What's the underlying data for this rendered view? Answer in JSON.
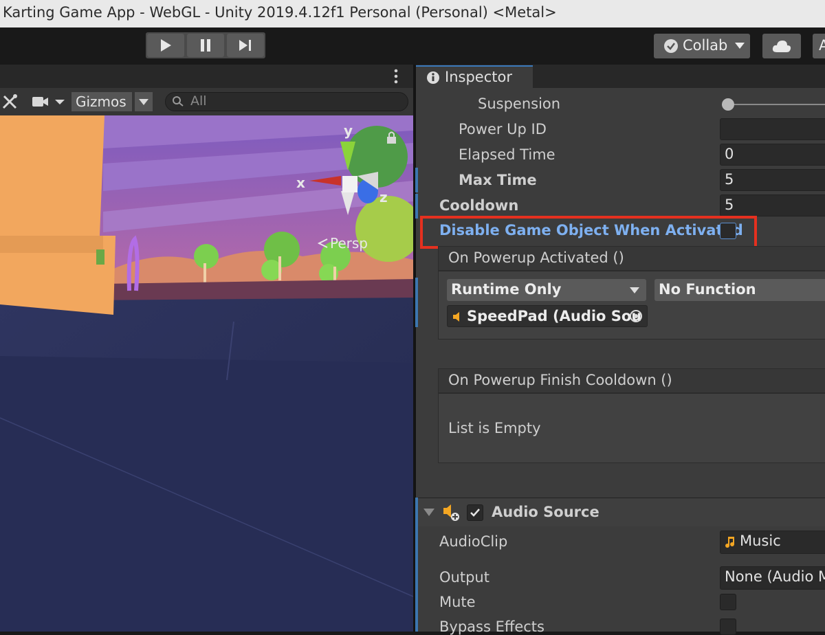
{
  "window": {
    "title": "Karting Game App - WebGL - Unity 2019.4.12f1 Personal (Personal) <Metal>"
  },
  "toolbar": {
    "collab_label": "Collab",
    "account_label": "A",
    "play_icon": "play-icon",
    "pause_icon": "pause-icon",
    "step_icon": "step-icon"
  },
  "scene": {
    "gizmos_label": "Gizmos",
    "search_placeholder": "All",
    "axis_x": "x",
    "axis_y": "y",
    "axis_z": "z",
    "projection": "Persp"
  },
  "inspector": {
    "tab_label": "Inspector",
    "fields": {
      "suspension": "Suspension",
      "power_up_id": "Power Up ID",
      "power_up_id_value": "",
      "elapsed_time": "Elapsed Time",
      "elapsed_time_value": "0",
      "max_time": "Max Time",
      "max_time_value": "5",
      "cooldown": "Cooldown",
      "cooldown_value": "5",
      "disable_when_activated": "Disable Game Object When Activated"
    },
    "on_activated": {
      "header": "On Powerup Activated ()",
      "runtime_mode": "Runtime Only",
      "function": "No Function",
      "target_object": "SpeedPad (Audio Sou"
    },
    "on_finish_cooldown": {
      "header": "On Powerup Finish Cooldown ()",
      "empty_text": "List is Empty"
    },
    "audio_source": {
      "title": "Audio Source",
      "audioclip_label": "AudioClip",
      "audioclip_value": "Music",
      "output_label": "Output",
      "output_value": "None (Audio M",
      "mute_label": "Mute",
      "bypass_label": "Bypass Effects"
    }
  },
  "colors": {
    "highlight": "#e5301f",
    "label_highlight": "#7eb0f0",
    "accent_blue": "#3a79bb"
  }
}
